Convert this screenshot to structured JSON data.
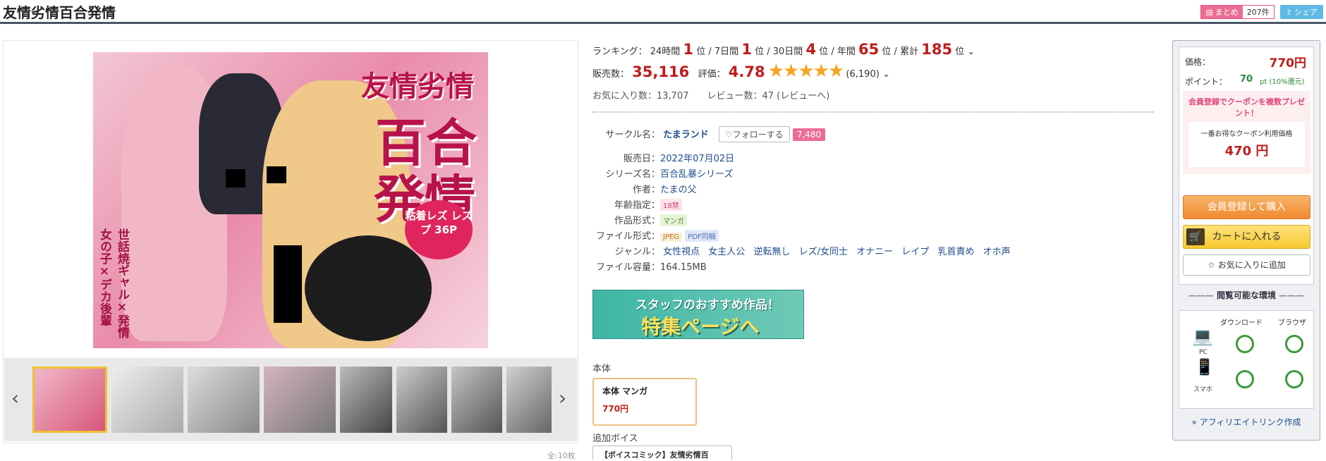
{
  "header": {
    "title": "友情劣情百合発情",
    "matome_label": "まとめ",
    "matome_count": "207件",
    "share_label": "シェア"
  },
  "gallery": {
    "cover_title_1": "友情劣情",
    "cover_title_2": "百合",
    "cover_title_3": "発情",
    "cover_badge": "粘着レズ レズプ 36P",
    "cover_side": "世話焼ギャル×発情女の子×デカ後輩",
    "count_label": "全:10枚",
    "thumb_count": 8,
    "selected_thumb": 1
  },
  "ranking": {
    "label": "ランキング：",
    "h24_label": "24時間",
    "h24": "1",
    "d7_label": "7日間",
    "d7": "1",
    "d30_label": "30日間",
    "d30": "4",
    "year_label": "年間",
    "year": "65",
    "total_label": "累計",
    "total": "185",
    "unit": "位"
  },
  "sales": {
    "label": "販売数：",
    "value": "35,116",
    "rating_label": "評価：",
    "rating": "4.78",
    "stars": "★★★★★",
    "count": "(6,190)"
  },
  "stats": {
    "text": "お気に入り数：13,707　　レビュー数：47 (レビューへ)"
  },
  "details": {
    "circle_label": "サークル名：",
    "circle": "たまランド",
    "follow": "フォローする",
    "follow_count": "7,480",
    "date_label": "販売日：",
    "date": "2022年07月02日",
    "series_label": "シリーズ名：",
    "series": "百合乱暴シリーズ",
    "author_label": "作者：",
    "author": "たまの父",
    "age_label": "年齢指定：",
    "age": "18禁",
    "format_label": "作品形式：",
    "format": "マンガ",
    "file_label": "ファイル形式：",
    "file1": "JPEG",
    "file2": "PDF同梱",
    "genre_label": "ジャンル：",
    "genres": [
      "女性視点",
      "女主人公",
      "逆転無し",
      "レズ/女同士",
      "オナニー",
      "レイプ",
      "乳首責め",
      "オホ声"
    ],
    "size_label": "ファイル容量：",
    "size": "164.15MB"
  },
  "banner": {
    "line1": "スタッフのおすすめ作品！",
    "line2": "特集ページへ"
  },
  "edition": {
    "section": "本体",
    "name": "本体 マンガ",
    "price": "770円",
    "voice_section": "追加ボイス",
    "voice_item": "【ボイスコミック】友情劣情百"
  },
  "buy": {
    "price_label": "価格：",
    "price": "770円",
    "point_label": "ポイント：",
    "point": "70",
    "point_unit": "pt (10%還元)",
    "coupon_title": "会員登録でクーポンを複数プレゼント！",
    "coupon_sub": "一番お得なクーポン利用価格",
    "coupon_price": "470 円",
    "register_btn": "会員登録して購入",
    "cart_btn": "カートに入れる",
    "fav_btn": "お気に入りに追加",
    "env_title": "閲覧可能な環境",
    "env_dl": "ダウンロード",
    "env_br": "ブラウザ",
    "env_pc": "PC",
    "env_sp": "スマホ",
    "affiliate": "» アフィリエイトリンク作成"
  },
  "colors": {
    "accent_red": "#c01c1c",
    "link": "#1f4d8f",
    "star": "#f5a623",
    "button_orange": "#f5a04a"
  }
}
